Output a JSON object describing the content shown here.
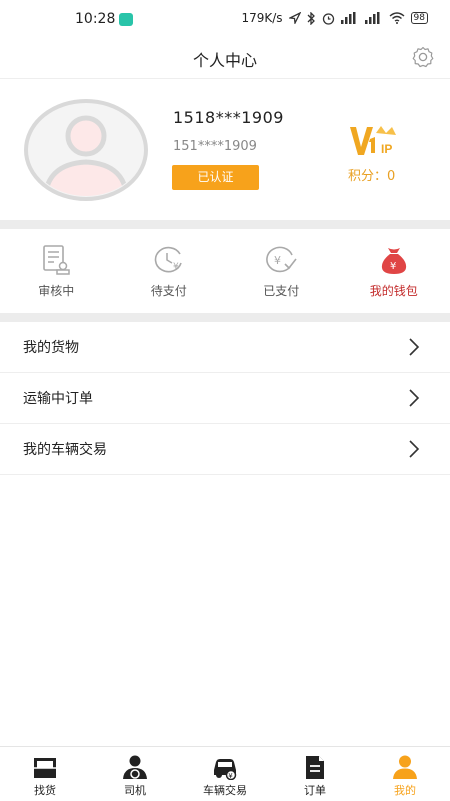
{
  "status_bar": {
    "time": "10:28",
    "network_speed": "179K/s",
    "battery": "98"
  },
  "header": {
    "title": "个人中心",
    "settings_icon": "gear-icon"
  },
  "profile": {
    "phone": "1518***1909",
    "phone_masked": "151****1909",
    "verified_label": "已认证",
    "points_label": "积分：0",
    "vip_logo_text": "VIP"
  },
  "order_status": [
    {
      "label": "审核中",
      "icon": "review-icon"
    },
    {
      "label": "待支付",
      "icon": "pending-payment-icon"
    },
    {
      "label": "已支付",
      "icon": "paid-icon"
    },
    {
      "label": "我的钱包",
      "icon": "wallet-bag-icon"
    }
  ],
  "menu": [
    {
      "label": "我的货物"
    },
    {
      "label": "运输中订单"
    },
    {
      "label": "我的车辆交易"
    }
  ],
  "tabbar": [
    {
      "label": "找货",
      "icon": "cargo-icon"
    },
    {
      "label": "司机",
      "icon": "driver-icon"
    },
    {
      "label": "车辆交易",
      "icon": "car-trade-icon"
    },
    {
      "label": "订单",
      "icon": "order-icon"
    },
    {
      "label": "我的",
      "icon": "profile-icon",
      "active": true
    }
  ],
  "colors": {
    "accent": "#f7a21b",
    "wallet_red": "#c32b2b",
    "app_status_icon": "#29c4a9",
    "section_gap": "#ececec"
  }
}
